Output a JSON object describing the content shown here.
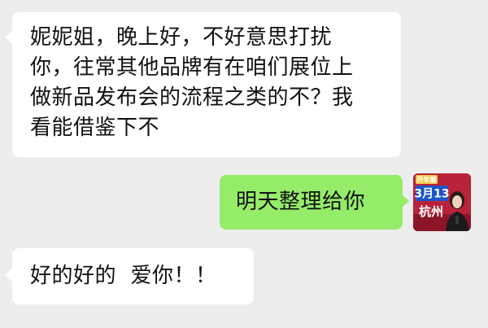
{
  "chat": {
    "messages": [
      {
        "direction": "incoming",
        "text": "妮妮姐，晚上好，不好意思打扰\n你，往常其他品牌有在咱们展位上\n做新品发布会的流程之类的不？我\n看能借鉴下不"
      },
      {
        "direction": "outgoing",
        "text": "明天整理给你"
      },
      {
        "direction": "incoming",
        "text": "好的好的  爱你！！"
      }
    ]
  },
  "avatar": {
    "badge": "开年展",
    "date": "3月13",
    "city": "杭州",
    "colors": {
      "background": "#b8233a",
      "badge": "#f2c94c",
      "date_box": "#1e56c8"
    }
  },
  "colors": {
    "chat_background": "#ededed",
    "incoming_bubble": "#ffffff",
    "outgoing_bubble": "#95ec69",
    "text": "#111111"
  }
}
